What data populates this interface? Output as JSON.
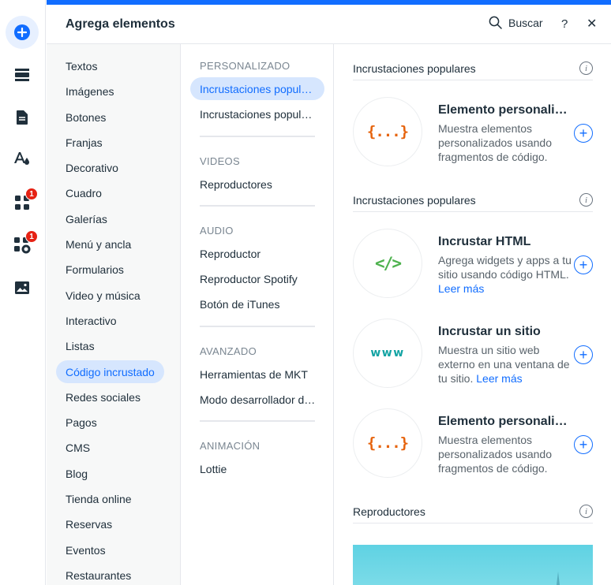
{
  "header": {
    "title": "Agrega elementos",
    "search_label": "Buscar",
    "help_label": "?",
    "close_label": "✕"
  },
  "rail": {
    "items": [
      {
        "icon": "add-icon"
      },
      {
        "icon": "sections-icon"
      },
      {
        "icon": "pages-icon"
      },
      {
        "icon": "design-icon"
      },
      {
        "icon": "apps-icon",
        "badge": "1"
      },
      {
        "icon": "business-apps-icon",
        "badge": "1"
      },
      {
        "icon": "media-icon"
      }
    ],
    "badge_color": "#e62214"
  },
  "categories": [
    "Textos",
    "Imágenes",
    "Botones",
    "Franjas",
    "Decorativo",
    "Cuadro",
    "Galerías",
    "Menú y ancla",
    "Formularios",
    "Video y música",
    "Interactivo",
    "Listas",
    "Código incrustado",
    "Redes sociales",
    "Pagos",
    "CMS",
    "Blog",
    "Tienda online",
    "Reservas",
    "Eventos",
    "Restaurantes"
  ],
  "active_category": "Código incrustado",
  "subcategories": {
    "sections": [
      {
        "title": "PERSONALIZADO",
        "items": [
          "Incrustaciones populares",
          "Incrustaciones populares"
        ]
      },
      {
        "title": "VIDEOS",
        "items": [
          "Reproductores"
        ]
      },
      {
        "title": "AUDIO",
        "items": [
          "Reproductor",
          "Reproductor Spotify",
          "Botón de iTunes"
        ]
      },
      {
        "title": "AVANZADO",
        "items": [
          "Herramientas de MKT",
          "Modo desarrollador de Wix"
        ]
      },
      {
        "title": "ANIMACIÓN",
        "items": [
          "Lottie"
        ]
      }
    ]
  },
  "content": {
    "sections": [
      {
        "title": "Incrustaciones populares",
        "cards": [
          {
            "title": "Elemento personalizado",
            "desc": "Muestra elementos personalizados usando fragmentos de código.",
            "link": "",
            "thumb": "{...}",
            "icon": "curly-braces-icon"
          }
        ]
      },
      {
        "title": "Incrustaciones populares",
        "cards": [
          {
            "title": "Incrustar HTML",
            "desc": "Agrega widgets y apps a tu sitio usando código HTML.",
            "link": "Leer más",
            "thumb": "</>",
            "icon": "code-tag-icon"
          },
          {
            "title": "Incrustar un sitio",
            "desc": "Muestra un sitio web externo en una ventana de tu sitio.",
            "link": "Leer más",
            "thumb": "www",
            "icon": "www-icon"
          },
          {
            "title": "Elemento personalizado",
            "desc": "Muestra elementos personalizados usando fragmentos de código.",
            "link": "",
            "thumb": "{...}",
            "icon": "curly-braces-icon"
          }
        ]
      },
      {
        "title": "Reproductores",
        "cards": []
      }
    ]
  },
  "colors": {
    "accent": "#116dff",
    "active_bg": "#d6e6fe",
    "braces": "#e6640e",
    "html": "#4eb24e",
    "www": "#12a3a3"
  }
}
